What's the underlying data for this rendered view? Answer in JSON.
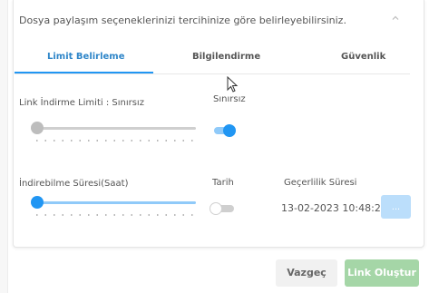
{
  "header": {
    "text": "Dosya paylaşım seçeneklerinizi tercihinize göre belirleyebilirsiniz."
  },
  "tabs": [
    {
      "label": "Limit Belirleme",
      "active": true
    },
    {
      "label": "Bilgilendirme",
      "active": false
    },
    {
      "label": "Güvenlik",
      "active": false
    }
  ],
  "link_limit": {
    "label": "Link İndirme Limiti : Sınırsız",
    "slider_value": 0,
    "toggle_label": "Sınırsız",
    "toggle_on": true
  },
  "download_duration": {
    "label": "İndirebilme Süresi(Saat)",
    "slider_value": 0,
    "toggle_label": "Tarih",
    "toggle_on": false
  },
  "validity": {
    "label": "Geçerlilik Süresi",
    "value": "13-02-2023 10:48:23",
    "picker_label": "..."
  },
  "footer": {
    "cancel_label": "Vazgeç",
    "create_label": "Link Oluştur"
  },
  "colors": {
    "accent": "#2196f3",
    "create_button": "#a5d6a7",
    "picker_button": "#bbdefb"
  }
}
